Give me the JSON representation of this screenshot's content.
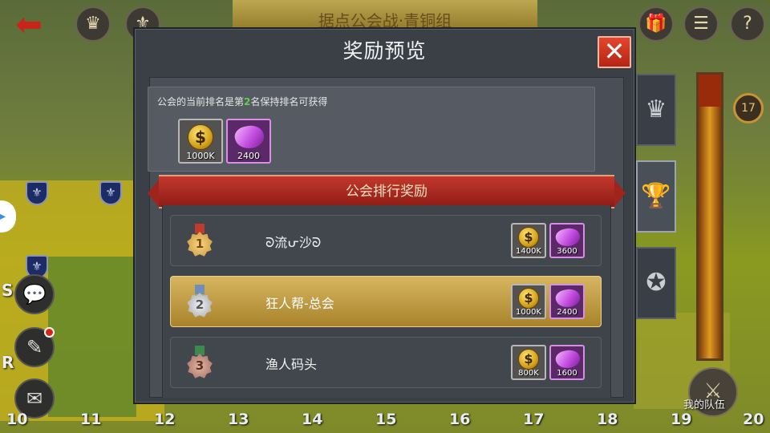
{
  "background": {
    "banner_title": "据点公会战·青铜组",
    "team_label": "我的队伍",
    "level_badge": "17",
    "column_numbers": [
      "10",
      "11",
      "12",
      "13",
      "14",
      "15",
      "16",
      "17",
      "18",
      "19",
      "20"
    ],
    "side_letters": [
      "S",
      "R"
    ]
  },
  "modal": {
    "title": "奖励预览",
    "close_icon": "close-icon",
    "current": {
      "prefix": "公会的当前排名是第",
      "rank": "2",
      "suffix": "名保持排名可获得",
      "rewards": [
        {
          "icon": "gold-coin-icon",
          "qty": "1000K"
        },
        {
          "icon": "purple-gem-icon",
          "qty": "2400"
        }
      ]
    },
    "ribbon_title": "公会排行奖励",
    "rankings": [
      {
        "rank": "1",
        "medal": "gold",
        "name": "ᘐ流ᕂ沙ᘐ",
        "coin": "1400K",
        "gem": "3600",
        "highlight": false
      },
      {
        "rank": "2",
        "medal": "silver",
        "name": "狂人帮-总会",
        "coin": "1000K",
        "gem": "2400",
        "highlight": true
      },
      {
        "rank": "3",
        "medal": "bronze",
        "name": "渔人码头",
        "coin": "800K",
        "gem": "1600",
        "highlight": false
      }
    ]
  },
  "tabs": [
    {
      "name": "crown-tab",
      "icon": "crown-icon",
      "active": false
    },
    {
      "name": "trophy-tab",
      "icon": "trophy-icon",
      "active": true
    },
    {
      "name": "medal-tab",
      "icon": "star-medal-icon",
      "active": false
    }
  ],
  "colors": {
    "rank_highlight": "#5ad24a",
    "ribbon": "#a92a20",
    "selected_row": "#c9a24a",
    "close_button": "#d0351f"
  }
}
